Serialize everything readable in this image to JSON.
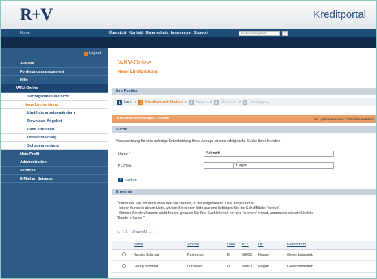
{
  "header": {
    "logo": "R+V",
    "portal_title": "Kreditportal"
  },
  "nav": {
    "home": "Home",
    "links": [
      "Übersicht",
      "Kontakt",
      "Datenschutz",
      "Impressum",
      "Support"
    ],
    "search": {
      "placeholder": "Suchwort eingeben",
      "go": "›"
    }
  },
  "sidebar": {
    "logout": "Logout",
    "items": [
      {
        "label": "Avalleis",
        "type": "main"
      },
      {
        "label": "Forderungsmanagement",
        "type": "main"
      },
      {
        "label": "Hilfe",
        "type": "main"
      },
      {
        "label": "WKV-Online",
        "type": "active"
      },
      {
        "label": "Vertragsdatenübersicht",
        "type": "sub"
      },
      {
        "label": "Neue Limitprüfung",
        "type": "current"
      },
      {
        "label": "Limitliste anzeigen/ändern",
        "type": "sub"
      },
      {
        "label": "Download-Angebot",
        "type": "sub"
      },
      {
        "label": "Limit streichen",
        "type": "sub"
      },
      {
        "label": "Umsatzmeldung",
        "type": "sub"
      },
      {
        "label": "Schadenmeldung",
        "type": "sub"
      },
      {
        "label": "Mein Profil",
        "type": "main"
      },
      {
        "label": "Administration",
        "type": "main"
      },
      {
        "label": "Services",
        "type": "main"
      },
      {
        "label": "E-Mail an Betreuer",
        "type": "main"
      }
    ]
  },
  "main": {
    "title": "WKV-Online",
    "subtitle": "Neue Limitprüfung",
    "position_bar": "Ihre Position",
    "steps": [
      {
        "num": "1",
        "label": "Land",
        "state": "done"
      },
      {
        "num": "2",
        "label": "Kundenidentifikation",
        "state": "on"
      },
      {
        "num": "3",
        "label": "Fragen",
        "state": "off"
      },
      {
        "num": "4",
        "label": "Übersicht",
        "state": "off"
      },
      {
        "num": "5",
        "label": "Bestätigung",
        "state": "off"
      }
    ],
    "step_separator": "»",
    "section_head": "Kundenidentifikation - Suche",
    "required_note": "mit * gekennzeichnete Felder bitte ausfüllen",
    "suche_bar": "Suche",
    "suche_desc": "Voraussetzung für eine sofortige Entscheidung Ihres Antrags ist eine erfolgreiche Suche Ihres Kunden.",
    "form": {
      "name_label": "Name *",
      "name_value": "Schmidt",
      "plz_label": "PLZ/Ort",
      "plz_value": "",
      "ort_value": "Hagen"
    },
    "search_button": "suchen",
    "ergebnis_bar": "Ergebnis",
    "info_lines": [
      "Überprüfen Sie, ob der Kunde den Sie suchen, in der dargestellten Liste aufgeführt ist.",
      "- Ist der Kunde in dieser Liste, wählen Sie diesen bitte aus und betätigen Sie die Schaltfläche \"weiter\".",
      "- Können Sie den Kunden nicht finden, grenzen Sie Ihre Suchkriterien ein und \"suchen\" erneut, ansonsten wählen Sie bitte",
      "\"Kunde erfassen\"."
    ],
    "pager": {
      "first": "|◂",
      "prev": "◂",
      "range": "1 - 10 von 51",
      "next": "▸",
      "last": "▸|"
    },
    "table": {
      "headers": [
        "",
        "Name",
        "Strasse",
        "Land",
        "PLZ",
        "Ort",
        "Rechtsform"
      ],
      "rows": [
        [
          "",
          "Kerstin Schmidt",
          "Pasteurstr.",
          "D",
          "58095",
          "Hagen",
          "Gewerbebetrieb"
        ],
        [
          "",
          "Georg Schmidt",
          "Lützowstr.",
          "D",
          "58091",
          "Hagen",
          "Gewerbebetrieb"
        ]
      ]
    }
  }
}
